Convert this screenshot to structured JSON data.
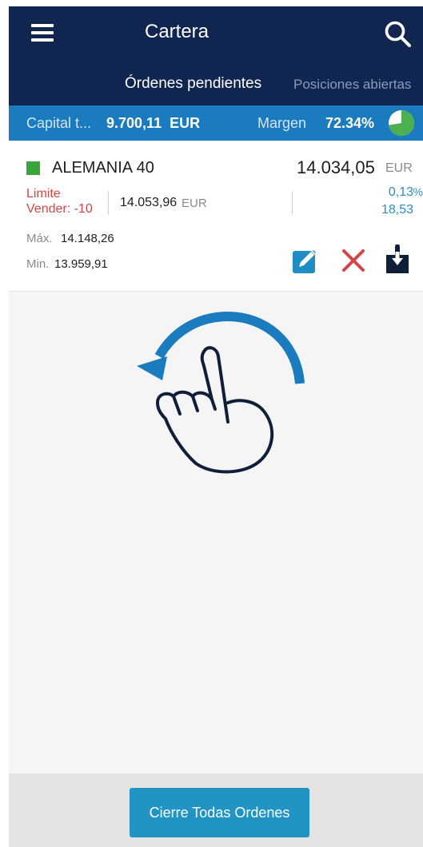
{
  "header": {
    "title": "Cartera",
    "tabs": [
      {
        "label": "Órdenes pendientes",
        "active": true
      },
      {
        "label": "Posiciones abiertas",
        "active": false
      }
    ]
  },
  "account": {
    "capital_label": "Capital t...",
    "capital_value": "9.700,11  EUR",
    "margin_label": "Margen",
    "margin_value": "72.34%",
    "margin_fraction": 0.7234
  },
  "order": {
    "instrument": "ALEMANIA 40",
    "status_color": "#3aa53a",
    "price": "14.034,05",
    "price_currency": "EUR",
    "type": "Limite",
    "side": "Vender: -10",
    "order_price": "14.053,96",
    "order_currency": "EUR",
    "change_pct": "0,13",
    "pct_sign": "%",
    "change": "18,53",
    "max_label": "Máx.",
    "max_value": "14.148,26",
    "min_label": "Min.",
    "min_value": "13.959,91",
    "actions": [
      "edit-icon",
      "close-icon",
      "download-icon"
    ]
  },
  "gesture": {
    "icon": "swipe-hand-icon"
  },
  "footer": {
    "button_label": "Cierre Todas Ordenes"
  },
  "colors": {
    "header_bg": "#102650",
    "bar_bg": "#1a7bbe",
    "accent": "#2294c4",
    "negative": "#d64545",
    "positive_pie": "#4caf50"
  }
}
